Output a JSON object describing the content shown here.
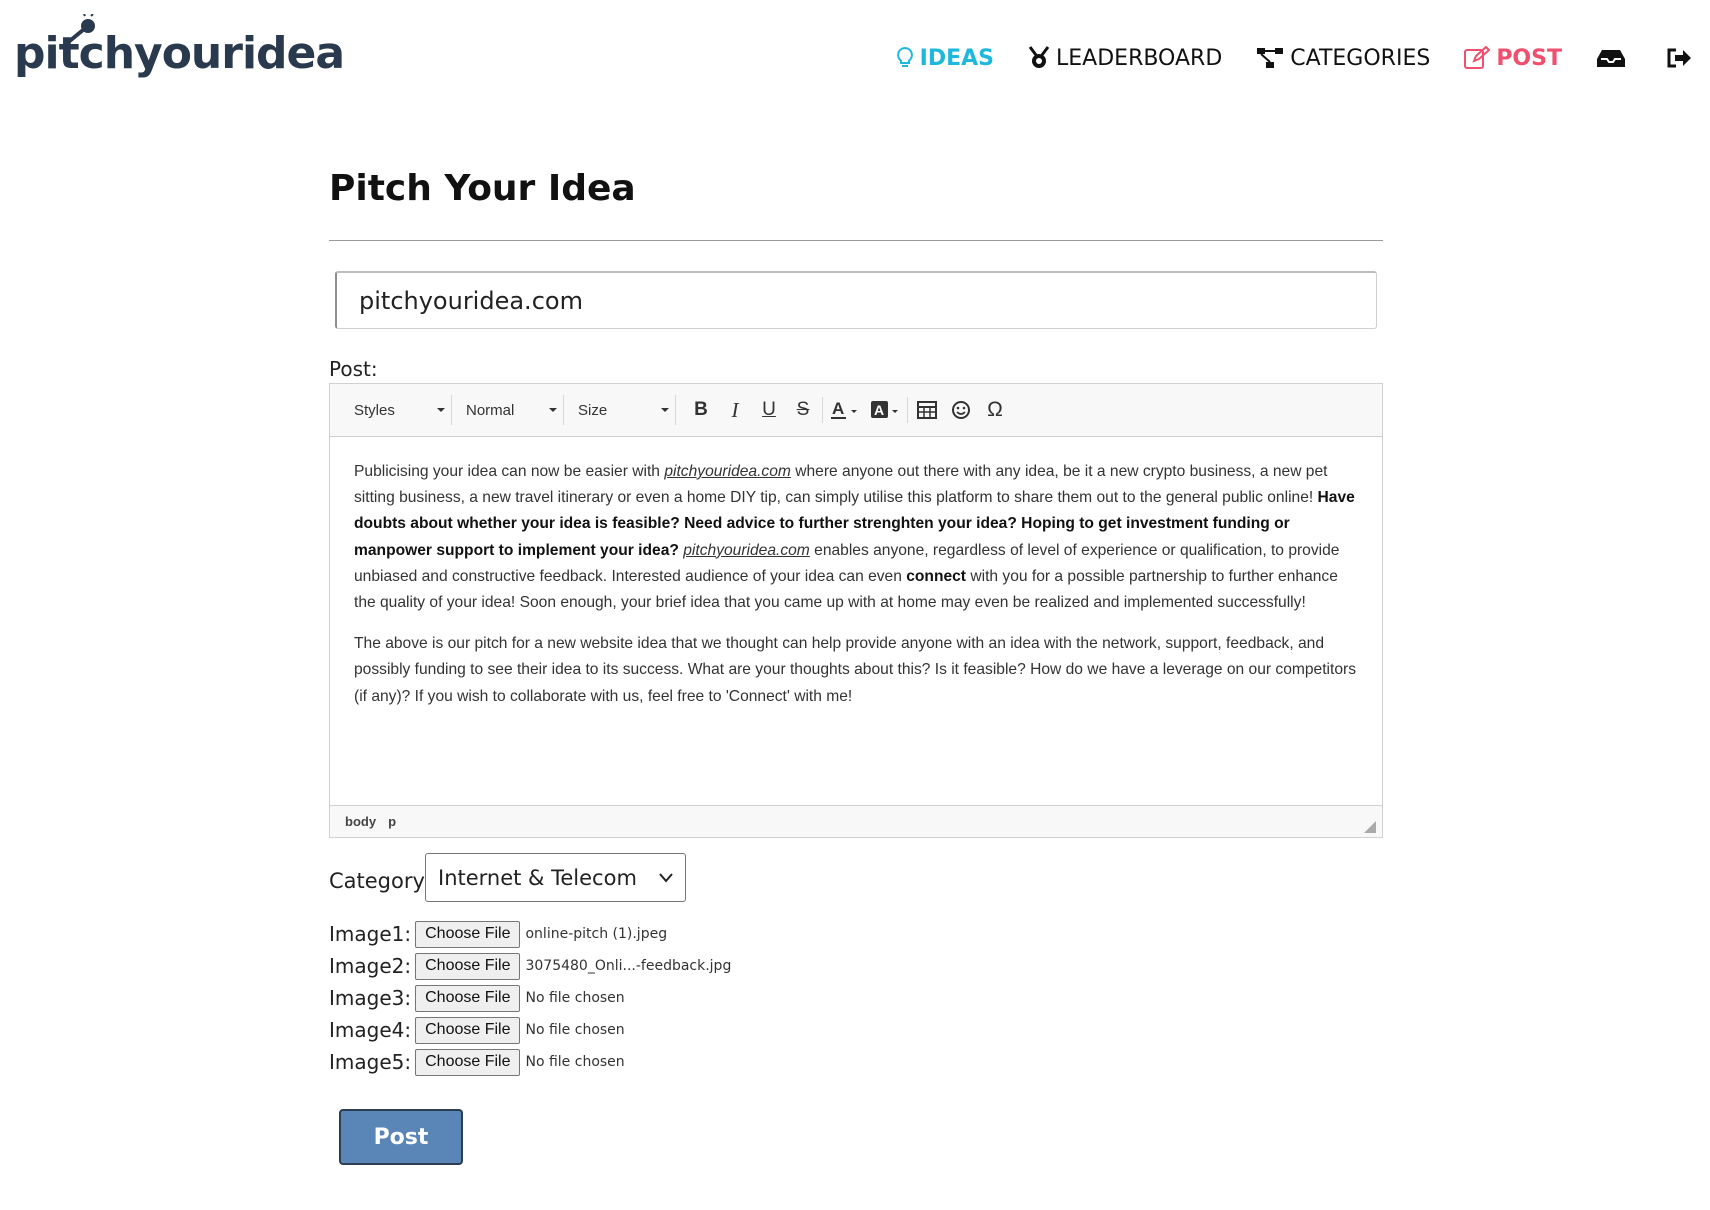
{
  "brand": {
    "logo_text": "pitchyouridea"
  },
  "nav": {
    "ideas": "IDEAS",
    "leaderboard": "LEADERBOARD",
    "categories": "CATEGORIES",
    "post": "POST",
    "icons": [
      "lightbulb-icon",
      "medal-icon",
      "sitemap-icon",
      "pencil-square-icon",
      "inbox-icon",
      "sign-out-icon"
    ],
    "colors": {
      "active": "#1eb8dd",
      "post": "#f0506e",
      "default": "#111111"
    }
  },
  "page": {
    "title": "Pitch Your Idea",
    "title_input_value": "pitchyouridea.com",
    "post_label": "Post:"
  },
  "editor": {
    "toolbar": {
      "styles": "Styles",
      "format": "Normal",
      "size": "Size"
    },
    "paragraph1": {
      "t1": "Publicising your idea can now be easier with ",
      "link1": "pitchyouridea.com",
      "t2": " where anyone out there with any idea, be it a new crypto business, a new pet sitting business, a new travel itinerary or even a home DIY tip, can simply utilise this platform to share them out to the general public online! ",
      "bold1": "Have doubts about whether your idea is feasible? Need advice to further strenghten your idea? Hoping to get investment funding or manpower support to implement your idea?",
      "t3": " ",
      "link2": "pitchyouridea.com",
      "t4": " enables anyone, regardless of level of experience or qualification, to provide unbiased and constructive feedback. Interested audience of your idea can even ",
      "bold2": "connect",
      "t5": " with you for a possible partnership to further enhance the quality of your idea! Soon enough, your brief idea that you came up with at home may even be realized and implemented successfully!"
    },
    "paragraph2": "The above is our pitch for a new website idea that we thought can help provide anyone with an idea with the network, support, feedback, and possibly funding to see their idea to its success. What are your thoughts about this? Is it feasible? How do we have a leverage on our competitors (if any)? If you wish to collaborate with us, feel free to 'Connect' with me!",
    "path": [
      "body",
      "p"
    ]
  },
  "category": {
    "label": "Category:",
    "selected": "Internet & Telecom"
  },
  "images": [
    {
      "label": "Image1:",
      "button": "Choose File",
      "file": "online-pitch (1).jpeg"
    },
    {
      "label": "Image2:",
      "button": "Choose File",
      "file": "3075480_Onli...-feedback.jpg"
    },
    {
      "label": "Image3:",
      "button": "Choose File",
      "file": "No file chosen"
    },
    {
      "label": "Image4:",
      "button": "Choose File",
      "file": "No file chosen"
    },
    {
      "label": "Image5:",
      "button": "Choose File",
      "file": "No file chosen"
    }
  ],
  "submit": {
    "label": "Post",
    "color": "#5a86b7"
  }
}
